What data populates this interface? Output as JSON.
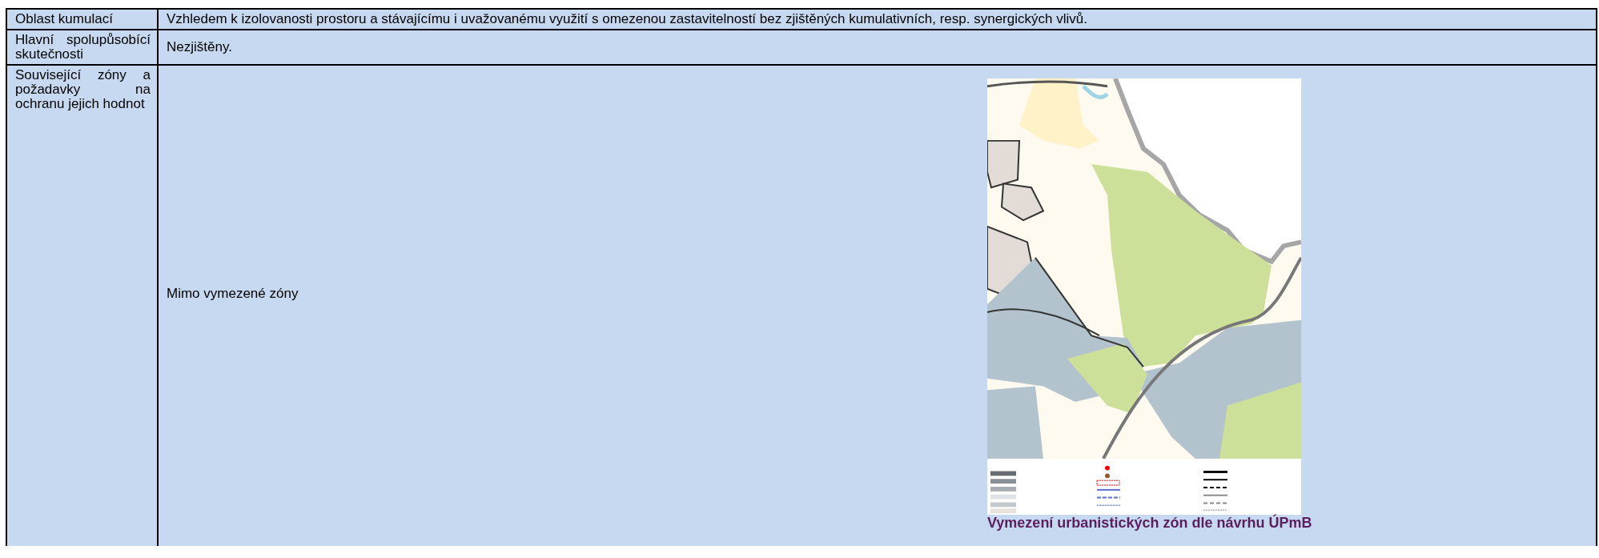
{
  "table": {
    "rows": [
      {
        "label": "Oblast kumulací",
        "content": {
          "kind": "text",
          "text": "Vzhledem k izolovanosti prostoru a stávajícímu i uvažovanému využití s omezenou zastavitelností bez zjištěných kumulativních, resp. synergických vlivů."
        }
      },
      {
        "label": "Hlavní spolupůsobící skutečnosti",
        "content": {
          "kind": "text",
          "text": "Nezjištěny."
        }
      },
      {
        "label": "Související zóny a požadavky na ochranu jejich hodnot",
        "content": {
          "kind": "figure",
          "text": "Mimo vymezené zóny",
          "caption": "Vymezení urbanistických zón dle návrhu ÚPmB"
        }
      }
    ]
  }
}
